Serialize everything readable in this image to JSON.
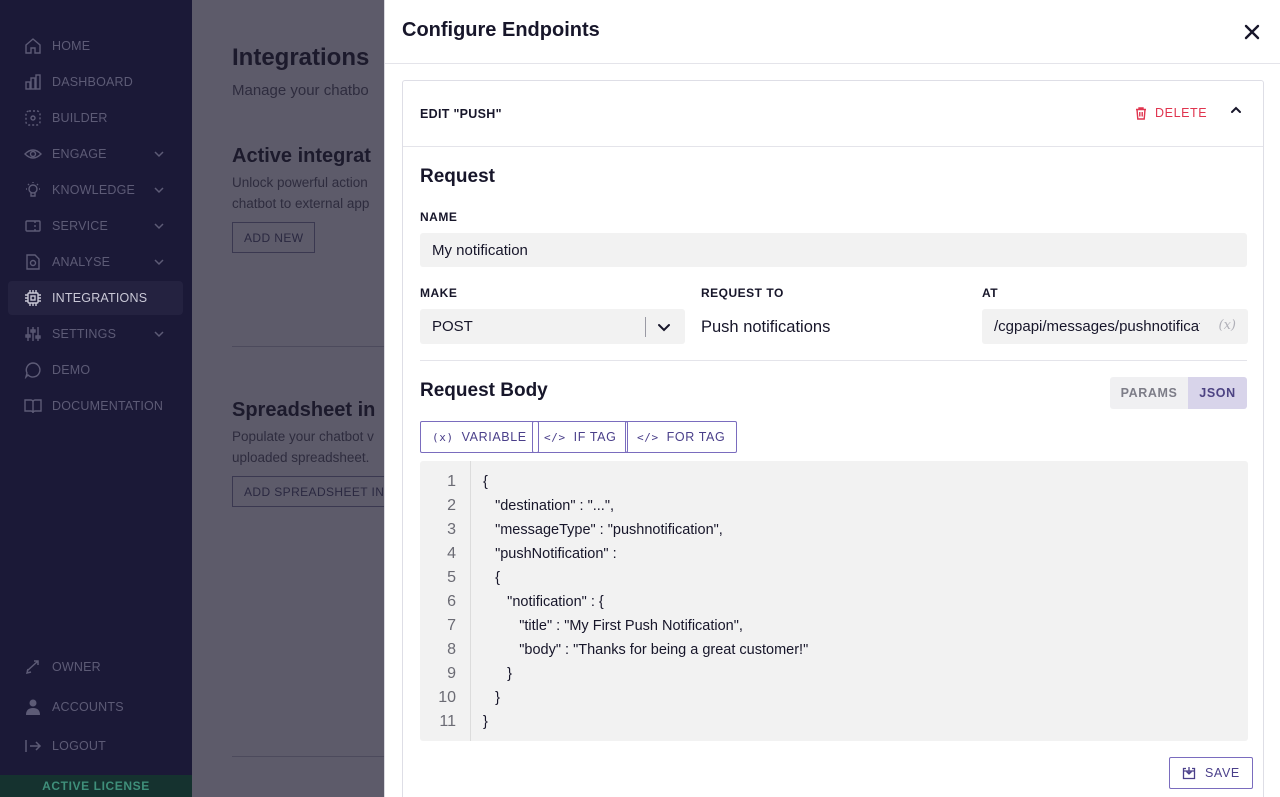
{
  "sidebar": {
    "items": [
      {
        "label": "HOME",
        "icon": "home-icon"
      },
      {
        "label": "DASHBOARD",
        "icon": "chart-icon"
      },
      {
        "label": "BUILDER",
        "icon": "builder-icon"
      },
      {
        "label": "ENGAGE",
        "icon": "eye-icon"
      },
      {
        "label": "KNOWLEDGE",
        "icon": "lightbulb-icon"
      },
      {
        "label": "SERVICE",
        "icon": "ticket-icon"
      },
      {
        "label": "ANALYSE",
        "icon": "document-search-icon"
      },
      {
        "label": "INTEGRATIONS",
        "icon": "integrations-icon"
      },
      {
        "label": "SETTINGS",
        "icon": "sliders-icon"
      },
      {
        "label": "DEMO",
        "icon": "chat-icon"
      },
      {
        "label": "DOCUMENTATION",
        "icon": "book-icon"
      }
    ],
    "bottom": [
      {
        "label": "OWNER",
        "icon": "swap-icon"
      },
      {
        "label": "ACCOUNTS",
        "icon": "user-icon"
      },
      {
        "label": "LOGOUT",
        "icon": "logout-icon"
      }
    ],
    "license": "ACTIVE LICENSE"
  },
  "background": {
    "title": "Integrations",
    "subtitle": "Manage your chatbo",
    "active_title": "Active integrat",
    "active_desc1": "Unlock powerful action",
    "active_desc2": "chatbot to external app",
    "add_new": "ADD NEW",
    "sheet_title": "Spreadsheet in",
    "sheet_desc1": "Populate your chatbot v",
    "sheet_desc2": "uploaded spreadsheet.",
    "sheet_btn": "ADD SPREADSHEET INT"
  },
  "panel": {
    "title": "Configure Endpoints",
    "edit_title": "EDIT \"PUSH\"",
    "delete_label": "DELETE",
    "request_heading": "Request",
    "name_label": "NAME",
    "name_value": "My notification",
    "make_label": "MAKE",
    "make_value": "POST",
    "request_to_label": "REQUEST TO",
    "request_to_value": "Push notifications",
    "at_label": "AT",
    "at_value": "/cgpapi/messages/pushnotifications",
    "variable_symbol": "(x)",
    "body_heading": "Request Body",
    "toggle": {
      "params": "PARAMS",
      "json": "JSON",
      "selected": "JSON"
    },
    "tag_buttons": {
      "variable": "VARIABLE",
      "if_tag": "IF TAG",
      "for_tag": "FOR TAG"
    },
    "tag_icons": {
      "variable": "(x)",
      "code": "</>"
    },
    "code_lines": [
      "{",
      "   \"destination\" : \"...\",",
      "   \"messageType\" : \"pushnotification\",",
      "   \"pushNotification\" :",
      "   {",
      "      \"notification\" : {",
      "         \"title\" : \"My First Push Notification\",",
      "         \"body\" : \"Thanks for being a great customer!\"",
      "      }",
      "   }",
      "}"
    ],
    "line_numbers": [
      "1",
      "2",
      "3",
      "4",
      "5",
      "6",
      "7",
      "8",
      "9",
      "10",
      "11"
    ],
    "save_label": "SAVE"
  },
  "colors": {
    "sidebar_bg": "#1b1937",
    "accent": "#7a6cbe",
    "danger": "#e0344e",
    "license_green": "#3f8f7a"
  }
}
